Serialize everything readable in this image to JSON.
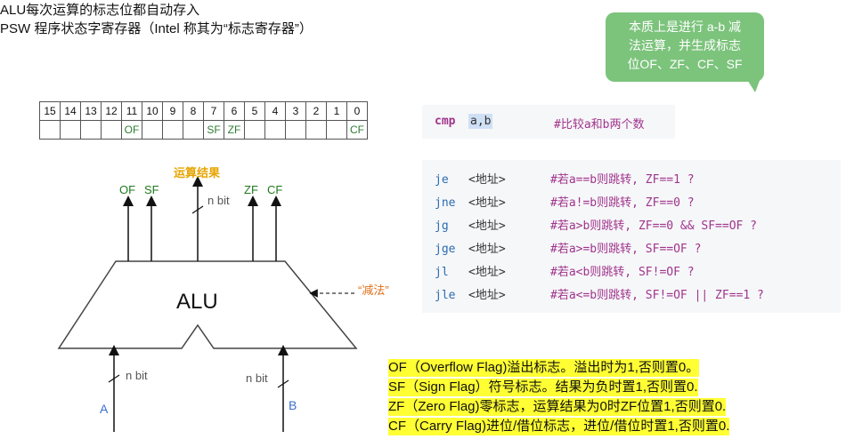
{
  "header": {
    "line1": "ALU每次运算的标志位都自动存入",
    "line2": "PSW 程序状态字寄存器（Intel 称其为“标志寄存器”）"
  },
  "psw_table": {
    "bits": [
      "15",
      "14",
      "13",
      "12",
      "11",
      "10",
      "9",
      "8",
      "7",
      "6",
      "5",
      "4",
      "3",
      "2",
      "1",
      "0"
    ],
    "flags": [
      "",
      "",
      "",
      "",
      "OF",
      "",
      "",
      "",
      "SF",
      "ZF",
      "",
      "",
      "",
      "",
      "",
      "CF"
    ]
  },
  "callout": {
    "line1": "本质上是进行 a-b 减",
    "line2": "法运算，并生成标志",
    "line3": "位OF、ZF、CF、SF"
  },
  "cmp_code": {
    "op": "cmp",
    "args": "a,b",
    "comment": "#比较a和b两个数"
  },
  "jumps": [
    {
      "op": "je",
      "arg": "<地址>",
      "comment": "#若a==b则跳转, ZF==1 ?"
    },
    {
      "op": "jne",
      "arg": "<地址>",
      "comment": "#若a!=b则跳转, ZF==0 ?"
    },
    {
      "op": "jg",
      "arg": "<地址>",
      "comment": "#若a>b则跳转, ZF==0 && SF==OF ?"
    },
    {
      "op": "jge",
      "arg": "<地址>",
      "comment": "#若a>=b则跳转, SF==OF ?"
    },
    {
      "op": "jl",
      "arg": "<地址>",
      "comment": "#若a<b则跳转, SF!=OF ?"
    },
    {
      "op": "jle",
      "arg": "<地址>",
      "comment": "#若a<=b则跳转, SF!=OF || ZF==1 ?"
    }
  ],
  "flag_notes": [
    "OF（Overflow Flag)溢出标志。溢出时为1,否则置0。",
    "SF（Sign Flag）符号标志。结果为负时置1,否则置0.",
    "ZF（Zero Flag)零标志，运算结果为0时ZF位置1,否则置0.",
    "CF（Carry Flag)进位/借位标志，进位/借位时置1,否则置0."
  ],
  "diagram": {
    "alu": "ALU",
    "result_label": "运算结果",
    "of": "OF",
    "sf": "SF",
    "zf": "ZF",
    "cf": "CF",
    "nbit_out": "n bit",
    "nbit_a": "n bit",
    "nbit_b": "n bit",
    "input_a": "A",
    "input_b": "B",
    "subtract_label": "“减法”"
  },
  "colors": {
    "callout": "#7cc37c",
    "highlight": "#ffff33",
    "flag_green": "#1f7a1f",
    "result_orange": "#e6a400",
    "input_blue": "#3a6fd0",
    "code_keyword": "#a0348c",
    "code_op": "#2b6cb0"
  }
}
